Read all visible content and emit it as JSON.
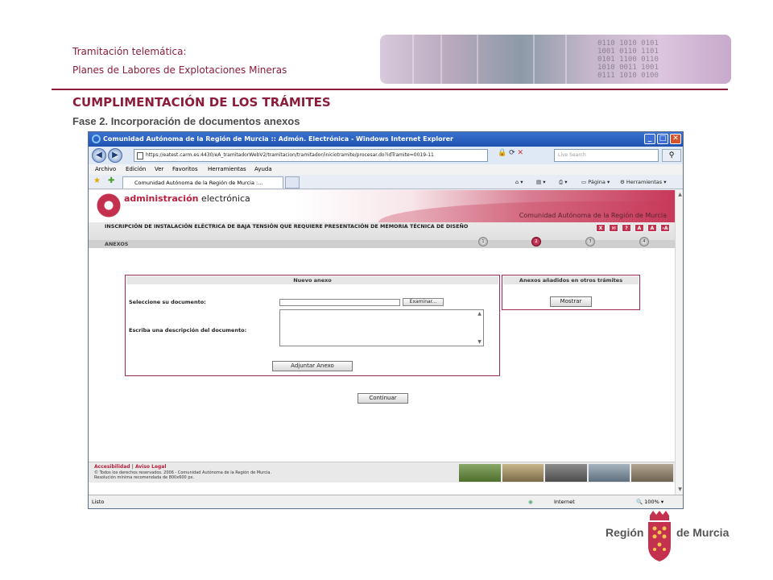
{
  "slide": {
    "subtitle_line1": "Tramitación telemática:",
    "subtitle_line2": "Planes de Labores de Explotaciones Mineras",
    "section_title": "CUMPLIMENTACIÓN DE LOS TRÁMITES",
    "phase_title": "Fase 2. Incorporación de documentos anexos"
  },
  "browser": {
    "window_title": "Comunidad Autónoma de la Región de Murcia :: Admón. Electrónica - Windows Internet Explorer",
    "address": "https://eatest.carm.es:4430/eA_tramitadorWebV2/tramitacion/tramitador/iniciotramite/procesar.do?idTramite=0019-11",
    "search_placeholder": "Live Search",
    "menu": [
      "Archivo",
      "Edición",
      "Ver",
      "Favoritos",
      "Herramientas",
      "Ayuda"
    ],
    "tab_label": "Comunidad Autónoma de la Región de Murcia :...",
    "tools": {
      "page": "Página",
      "tools": "Herramientas"
    },
    "status_text": "Listo",
    "zone": "Internet",
    "zoom": "100%"
  },
  "site": {
    "logo_bold": "administración",
    "logo_light": " electrónica",
    "region_name": "Comunidad Autónoma de la Región de Murcia",
    "procedure_title": "INSCRIPCIÓN DE INSTALACIÓN ELÉCTRICA DE BAJA TENSIÓN QUE REQUIERE PRESENTACIÓN DE MEMORIA TÉCNICA DE DISEÑO",
    "section": "ANEXOS",
    "header_buttons": [
      "X",
      "✉",
      "?",
      "A",
      "A",
      "-A"
    ],
    "steps": [
      "1",
      "2",
      "3",
      "4"
    ],
    "active_step": 2
  },
  "new_annex": {
    "heading": "Nuevo anexo",
    "select_label": "Seleccione su documento:",
    "browse_button": "Examinar...",
    "description_label": "Escriba una descripción del documento:",
    "attach_button": "Adjuntar Anexo"
  },
  "other_annexes": {
    "heading": "Anexos añadidos en otros trámites",
    "show_button": "Mostrar"
  },
  "continue_button": "Continuar",
  "footer": {
    "links": [
      "Accesibilidad",
      "Aviso Legal"
    ],
    "copyright": "© Todos los derechos reservados. 2006 - Comunidad Autónoma de la Región de Murcia.",
    "resolution": "Resolución mínima recomendada de 800x600 px."
  },
  "brand": {
    "left": "Región",
    "right": "de Murcia"
  },
  "colors": {
    "accent": "#8b1d3b",
    "brand_red": "#c4314f",
    "ie_blue": "#1f52b0"
  }
}
